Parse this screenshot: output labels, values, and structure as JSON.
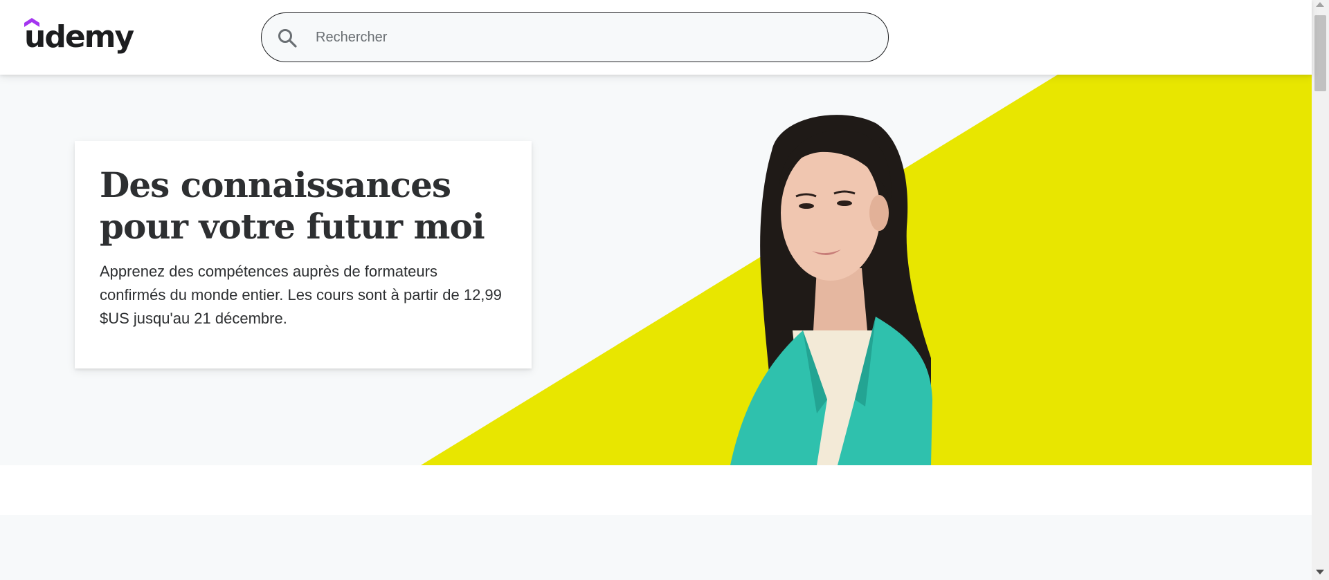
{
  "header": {
    "logo_text": "udemy",
    "search": {
      "placeholder": "Rechercher",
      "value": "",
      "icon": "search-icon"
    }
  },
  "hero": {
    "title": "Des connaissances pour votre futur moi",
    "text": "Apprenez des compétences auprès de formateurs confirmés du monde entier. Les cours sont à partir de 12,99 $US jusqu'au 21 décembre."
  },
  "colors": {
    "brand_purple": "#a435f0",
    "hero_yellow": "#e8e600",
    "jacket_teal": "#2fc1ad",
    "text_dark": "#2d2f31",
    "page_gray": "#f7f9fa"
  }
}
